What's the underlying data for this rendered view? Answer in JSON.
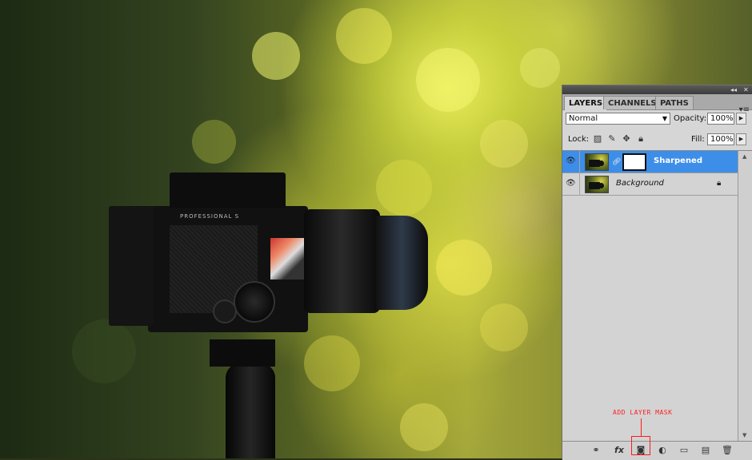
{
  "photo": {
    "subject": "camera-on-tripod-photo"
  },
  "camera": {
    "brand_text": "PROFESSIONAL S"
  },
  "panel": {
    "tabs": [
      {
        "label": "LAYERS",
        "active": true
      },
      {
        "label": "CHANNELS",
        "active": false
      },
      {
        "label": "PATHS",
        "active": false
      }
    ],
    "blend_mode": "Normal",
    "opacity_label": "Opacity:",
    "opacity_value": "100%",
    "lock_label": "Lock:",
    "fill_label": "Fill:",
    "fill_value": "100%",
    "layers": [
      {
        "name": "Sharpened",
        "selected": true,
        "has_mask": true
      },
      {
        "name": "Background",
        "selected": false,
        "locked": true
      }
    ]
  },
  "callout": {
    "text": "ADD LAYER MASK",
    "color": "#ff1a1a"
  },
  "colors": {
    "selection": "#3d8ee8",
    "panel_bg": "#d6d6d6"
  }
}
